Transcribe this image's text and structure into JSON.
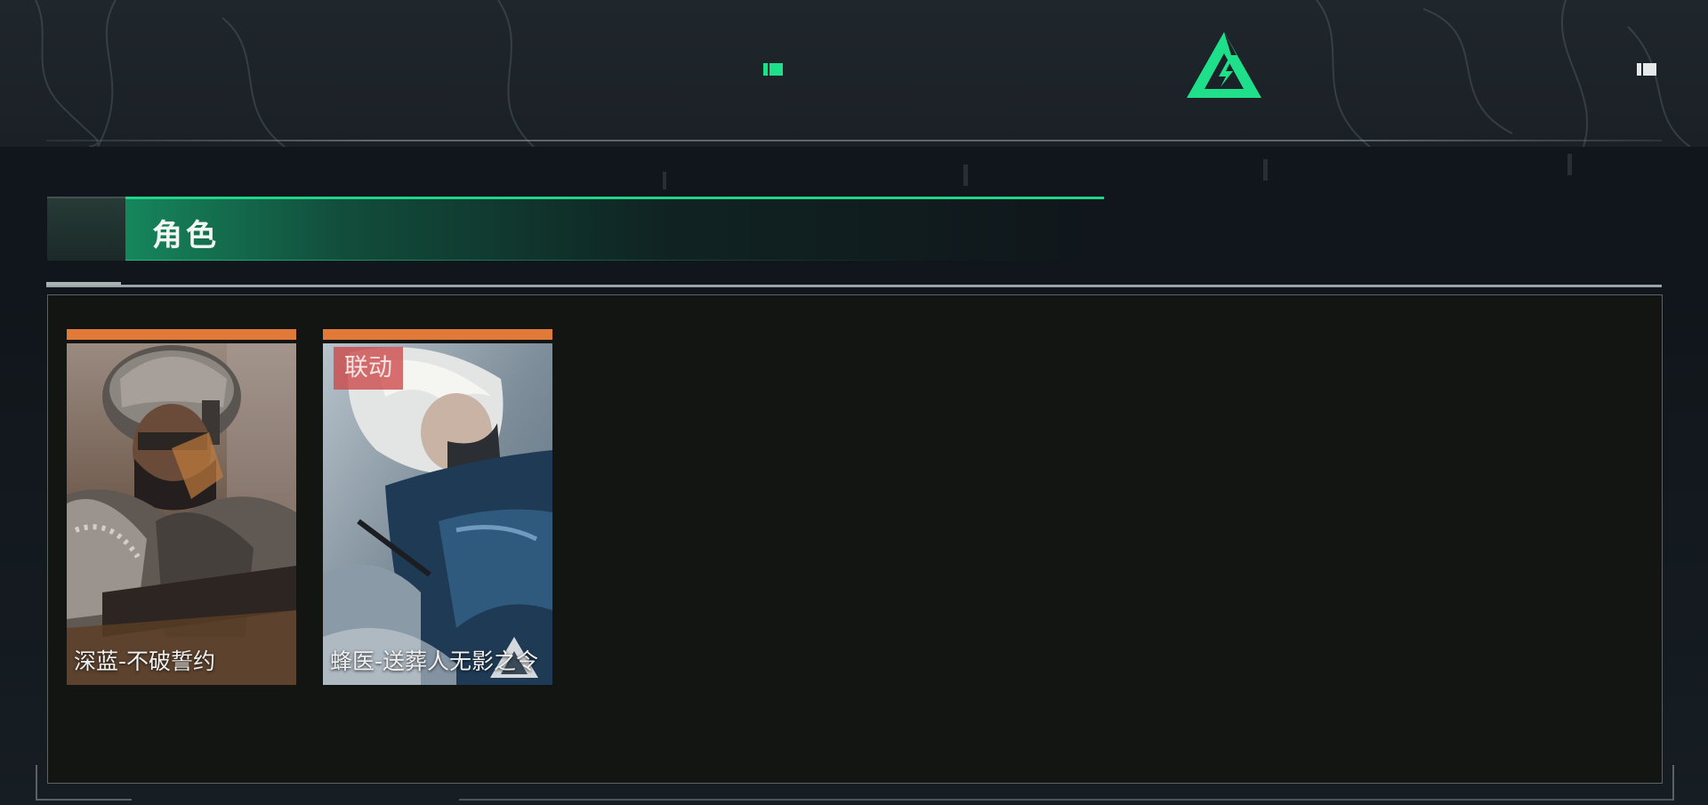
{
  "colors": {
    "accent_green": "#1fe08a",
    "rarity_orange": "#e17a39",
    "collab_tag_red": "#cc4848",
    "panel_bg": "#131513"
  },
  "header": {
    "left_nav_icon": "green-bar-flag-icon",
    "center_logo": "delta-triangle-logo",
    "right_nav_icon": "white-bar-flag-icon"
  },
  "section": {
    "title": "角色"
  },
  "cards": [
    {
      "name": "深蓝-不破誓约",
      "tag": "",
      "rarity_color": "#e17a39",
      "art_icon": "armored-operator-portrait"
    },
    {
      "name": "蜂医-送葬人无影之令",
      "tag": "联动",
      "rarity_color": "#e17a39",
      "art_icon": "white-haired-operator-portrait"
    }
  ]
}
